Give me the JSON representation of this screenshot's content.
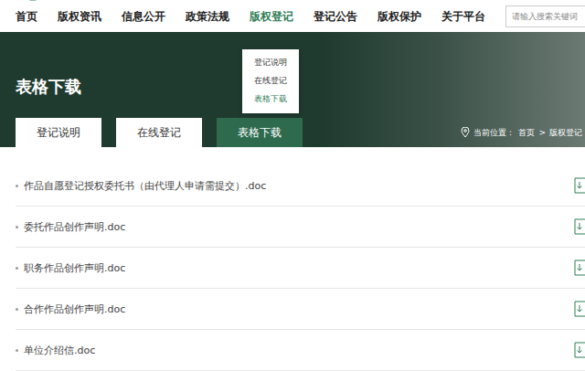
{
  "nav": [
    {
      "label": "首页",
      "selected": false
    },
    {
      "label": "版权资讯",
      "selected": false
    },
    {
      "label": "信息公开",
      "selected": false
    },
    {
      "label": "政策法规",
      "selected": false
    },
    {
      "label": "版权登记",
      "selected": true
    },
    {
      "label": "登记公告",
      "selected": false
    },
    {
      "label": "版权保护",
      "selected": false
    },
    {
      "label": "关于平台",
      "selected": false
    }
  ],
  "search": {
    "placeholder": "请输入搜索关键词"
  },
  "dropdown": [
    {
      "label": "登记说明",
      "selected": false
    },
    {
      "label": "在线登记",
      "selected": false
    },
    {
      "label": "表格下载",
      "selected": true
    }
  ],
  "banner": {
    "title": "表格下载"
  },
  "tabs": [
    {
      "label": "登记说明",
      "selected": false
    },
    {
      "label": "在线登记",
      "selected": false
    },
    {
      "label": "表格下载",
      "selected": true
    }
  ],
  "breadcrumb": {
    "label": "当前位置：",
    "separator": ">",
    "items": [
      "首页",
      "版权登记"
    ]
  },
  "files": [
    {
      "name": "作品自愿登记授权委托书（由代理人申请需提交）.doc"
    },
    {
      "name": "委托作品创作声明.doc"
    },
    {
      "name": "职务作品创作声明.doc"
    },
    {
      "name": "合作作品创作声明.doc"
    },
    {
      "name": "单位介绍信.doc"
    }
  ]
}
